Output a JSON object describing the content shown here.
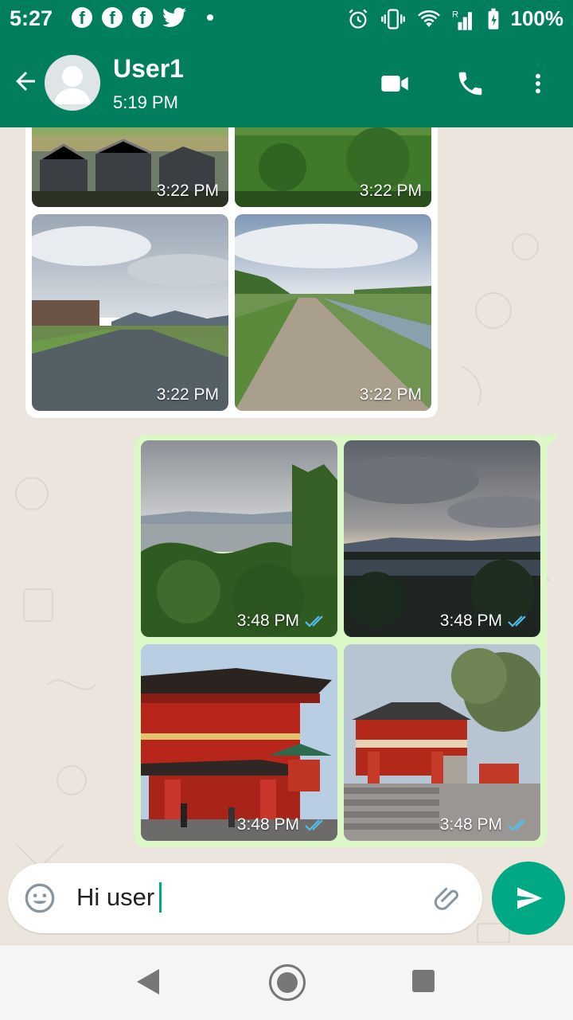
{
  "status_bar": {
    "time": "5:27",
    "notification_icons": [
      "facebook-icon",
      "facebook-icon",
      "facebook-icon",
      "twitter-icon",
      "more-dot"
    ],
    "battery_percent": "100%",
    "roaming_indicator": "R"
  },
  "header": {
    "contact_name": "User1",
    "last_seen": "5:19 PM"
  },
  "messages": {
    "incoming_photos": [
      {
        "time": "3:22 PM",
        "scene": "village-rooftops"
      },
      {
        "time": "3:22 PM",
        "scene": "green-field"
      },
      {
        "time": "3:22 PM",
        "scene": "river-city"
      },
      {
        "time": "3:22 PM",
        "scene": "riverside-path"
      }
    ],
    "outgoing_photos": [
      {
        "time": "3:48 PM",
        "scene": "city-forest-view"
      },
      {
        "time": "3:48 PM",
        "scene": "stormy-sky-city"
      },
      {
        "time": "3:48 PM",
        "scene": "red-temple-gate"
      },
      {
        "time": "3:48 PM",
        "scene": "shrine-steps"
      }
    ]
  },
  "composer": {
    "text": "Hi user"
  },
  "colors": {
    "header": "#007e5e",
    "accent": "#00a884",
    "outgoing_bubble": "#dcf8c6",
    "read_tick": "#53bdeb"
  }
}
